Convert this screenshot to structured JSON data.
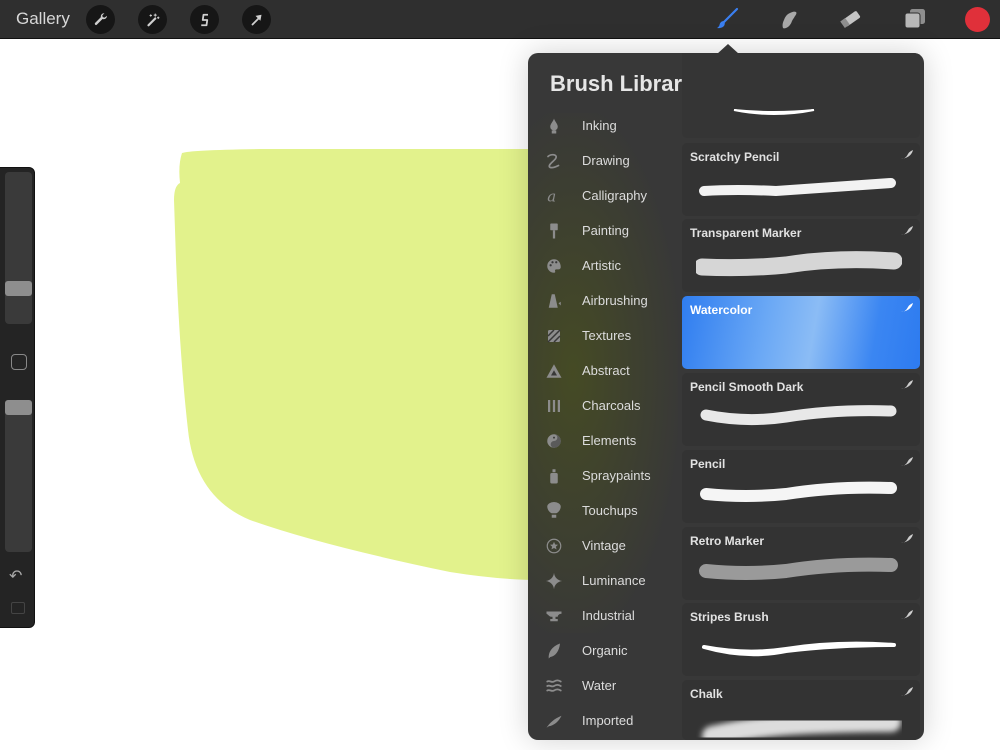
{
  "topbar": {
    "gallery_label": "Gallery",
    "left_tools": [
      {
        "name": "actions",
        "icon": "wrench-icon"
      },
      {
        "name": "adjustments",
        "icon": "magic-wand-icon"
      },
      {
        "name": "selection",
        "icon": "selection-s-icon"
      },
      {
        "name": "transform",
        "icon": "arrow-cursor-icon"
      }
    ],
    "right_tools": [
      {
        "name": "brush",
        "icon": "brush-icon",
        "active": true
      },
      {
        "name": "smudge",
        "icon": "smudge-finger-icon"
      },
      {
        "name": "eraser",
        "icon": "eraser-icon"
      },
      {
        "name": "layers",
        "icon": "layers-icon"
      }
    ],
    "current_color": "#e0303a",
    "active_tool_color": "#3a7ff0"
  },
  "canvas": {
    "shape_color": "#e2f28c",
    "background": "#ffffff"
  },
  "sidebar": {
    "brush_size_level": 0.8,
    "opacity_level": 0.0
  },
  "brush_library": {
    "title": "Brush Library",
    "add_icon": "plus-icon",
    "categories": [
      {
        "label": "Inking",
        "icon": "pen-nib-icon"
      },
      {
        "label": "Drawing",
        "icon": "squiggle-icon"
      },
      {
        "label": "Calligraphy",
        "icon": "calligraphy-a-icon"
      },
      {
        "label": "Painting",
        "icon": "paintbrush-icon"
      },
      {
        "label": "Artistic",
        "icon": "palette-icon"
      },
      {
        "label": "Airbrushing",
        "icon": "airbrush-icon"
      },
      {
        "label": "Textures",
        "icon": "texture-icon"
      },
      {
        "label": "Abstract",
        "icon": "triangle-icon"
      },
      {
        "label": "Charcoals",
        "icon": "charcoal-sticks-icon"
      },
      {
        "label": "Elements",
        "icon": "yin-yang-icon"
      },
      {
        "label": "Spraypaints",
        "icon": "spray-can-icon"
      },
      {
        "label": "Touchups",
        "icon": "touchup-brush-icon"
      },
      {
        "label": "Vintage",
        "icon": "star-circle-icon"
      },
      {
        "label": "Luminance",
        "icon": "sparkle-icon"
      },
      {
        "label": "Industrial",
        "icon": "anvil-icon"
      },
      {
        "label": "Organic",
        "icon": "leaf-icon"
      },
      {
        "label": "Water",
        "icon": "waves-icon"
      },
      {
        "label": "Imported",
        "icon": "feather-icon"
      }
    ],
    "brushes": [
      {
        "name": "",
        "partial": true
      },
      {
        "name": "Scratchy Pencil"
      },
      {
        "name": "Transparent Marker"
      },
      {
        "name": "Watercolor",
        "selected": true
      },
      {
        "name": "Pencil Smooth Dark"
      },
      {
        "name": "Pencil"
      },
      {
        "name": "Retro Marker"
      },
      {
        "name": "Stripes Brush"
      },
      {
        "name": "Chalk"
      }
    ]
  }
}
